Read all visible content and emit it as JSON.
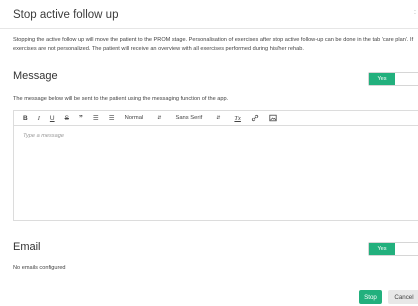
{
  "dialog": {
    "title": "Stop active follow up",
    "description": "Stopping the active follow up will move the patient to the PROM stage. Personalisation of exercises after stop active follow-up can be done in the tab 'care plan'. If exercises are not personalized. The patient will receive an overview with all exercises performed during his/her rehab."
  },
  "message": {
    "heading": "Message",
    "toggle_label": "Yes",
    "note": "The message below will be sent to the patient using the messaging function of the app.",
    "toolbar": {
      "bold": "B",
      "italic": "I",
      "underline": "U",
      "strike": "S",
      "quote": "”",
      "ordered_list": "☰",
      "bullet_list": "☰",
      "header_select": "Normal",
      "font_select": "Sans Serif",
      "clean": "Tx",
      "link": "🔗",
      "image": "▣"
    },
    "placeholder": "Type a message"
  },
  "email": {
    "heading": "Email",
    "toggle_label": "Yes",
    "status": "No emails configured"
  },
  "actions": {
    "stop": "Stop",
    "cancel": "Cancel"
  },
  "colors": {
    "accent": "#22b07d"
  }
}
